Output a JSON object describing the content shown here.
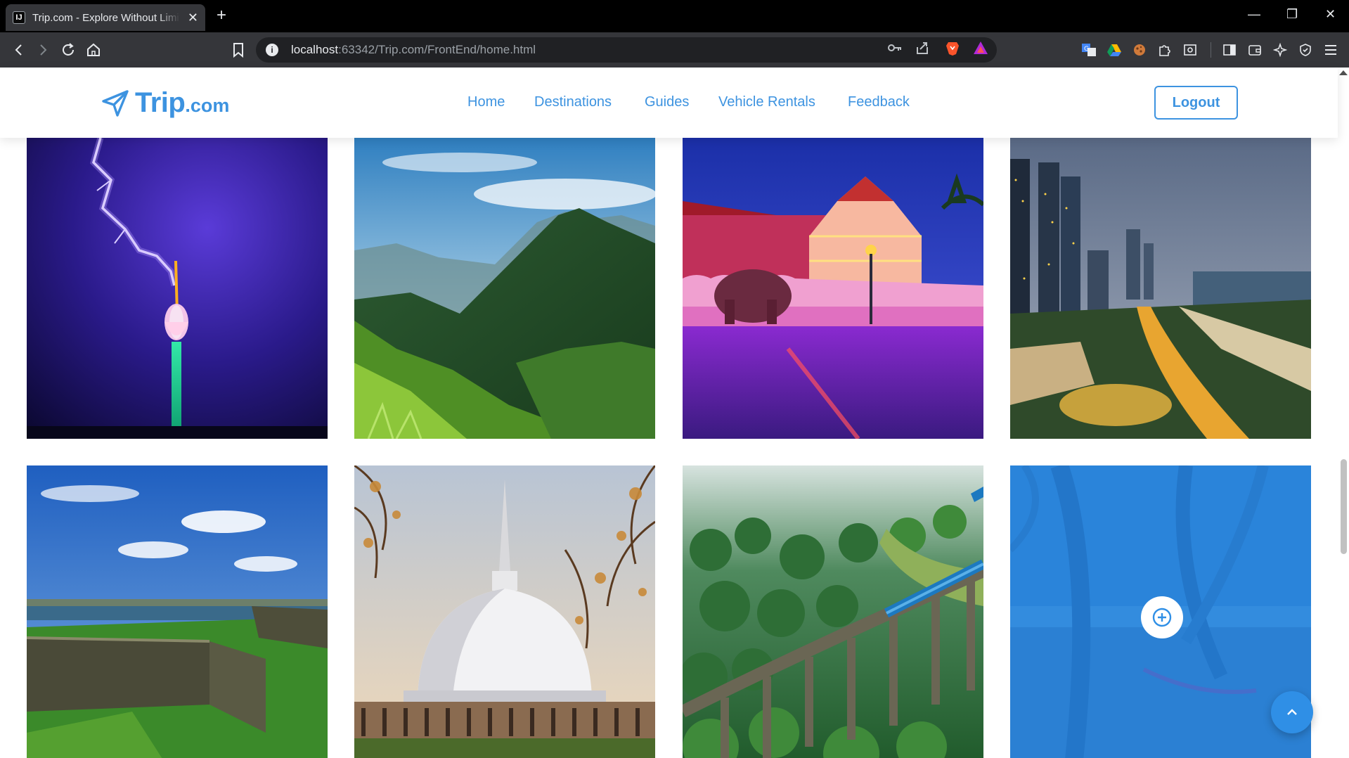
{
  "browser": {
    "tab_title": "Trip.com - Explore Without Limits",
    "tab_favicon_text": "IJ",
    "url_host": "localhost",
    "url_rest": ":63342/Trip.com/FrontEnd/home.html",
    "icons": [
      "back-icon",
      "forward-icon",
      "reload-icon",
      "home-icon",
      "bookmark-icon",
      "info-icon",
      "password-key-icon",
      "share-icon",
      "brave-shield-icon",
      "brave-rewards-icon",
      "translate-icon",
      "drive-icon",
      "cookie-icon",
      "extensions-icon",
      "screenshot-icon",
      "sidebar-icon",
      "wallet-icon",
      "leo-ai-icon",
      "vpn-icon",
      "menu-icon"
    ]
  },
  "site": {
    "logo_main": "Trip",
    "logo_suffix": ".com",
    "nav": [
      "Home",
      "Destinations",
      "Guides",
      "Vehicle Rentals",
      "Feedback"
    ],
    "logout_label": "Logout",
    "accent_color": "#3d93e0"
  },
  "gallery": {
    "tiles": [
      {
        "subject": "Lotus Tower with lightning at night"
      },
      {
        "subject": "Green misty mountain valley"
      },
      {
        "subject": "Temple of the Tooth illuminated at night with elephant"
      },
      {
        "subject": "Colombo city skyline at dusk"
      },
      {
        "subject": "Galle Fort ramparts"
      },
      {
        "subject": "Ruwanwelisaya white stupa"
      },
      {
        "subject": "Nine Arches Bridge with blue train"
      },
      {
        "subject": "Palm beach with hammock, blue overlay"
      }
    ],
    "add_icon": "plus-circle-icon",
    "to_top_icon": "chevron-up-icon"
  }
}
